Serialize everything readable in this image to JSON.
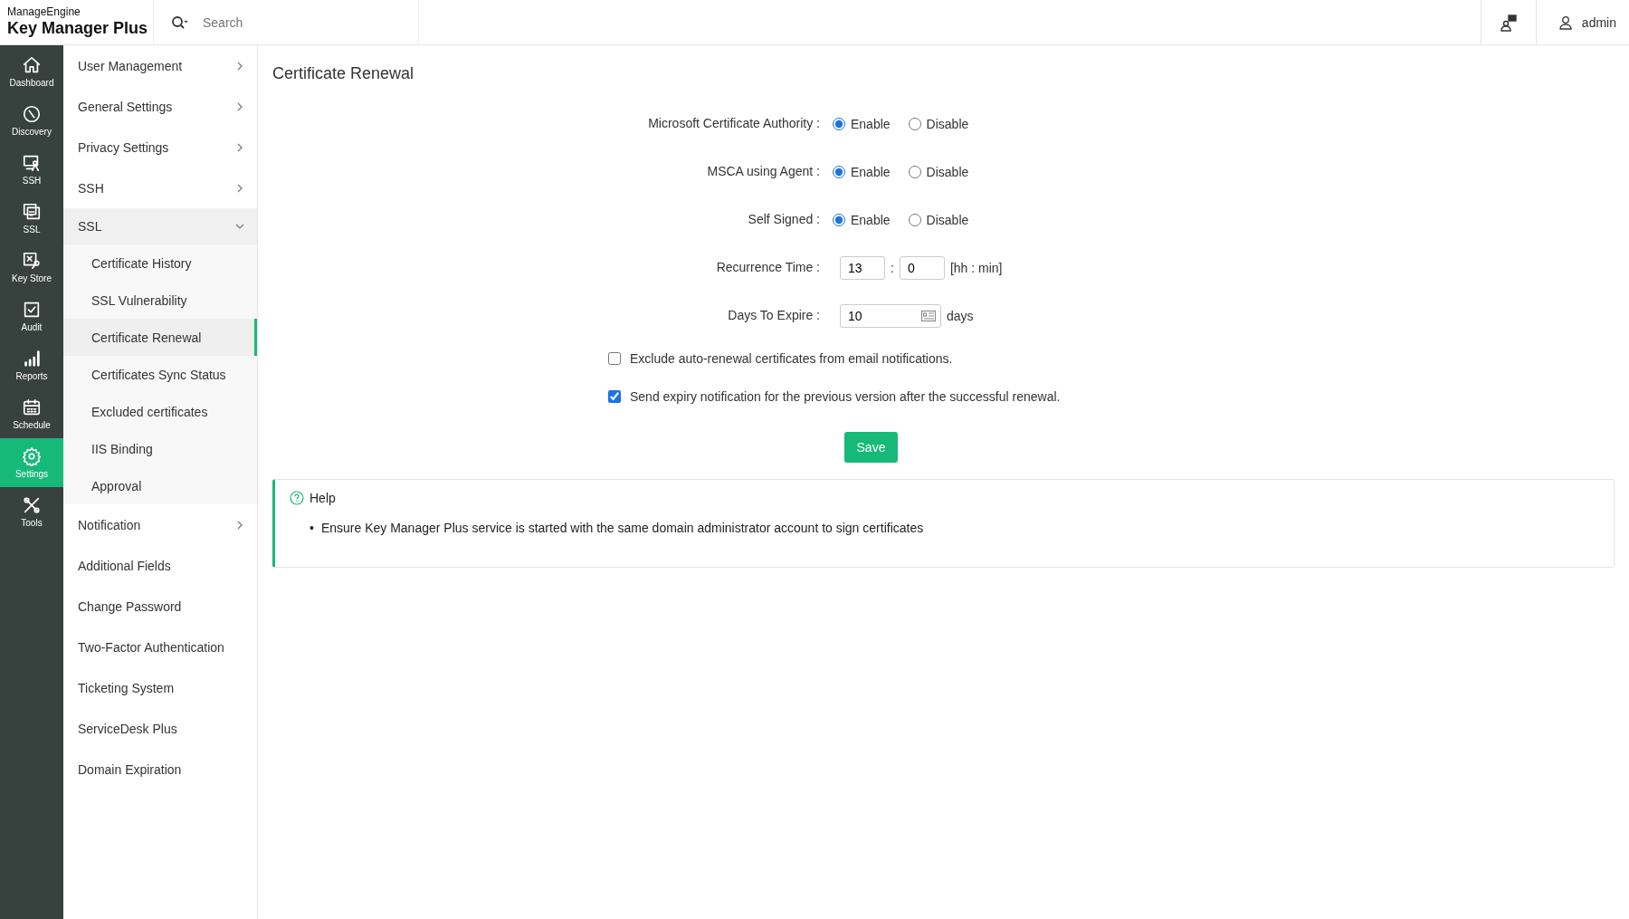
{
  "header": {
    "brand_top": "ManageEngine",
    "brand": "Key Manager Plus",
    "search": {
      "placeholder": "Search"
    },
    "user": "admin"
  },
  "rail": [
    {
      "label": "Dashboard",
      "selected": false
    },
    {
      "label": "Discovery",
      "selected": false
    },
    {
      "label": "SSH",
      "selected": false
    },
    {
      "label": "SSL",
      "selected": false
    },
    {
      "label": "Key Store",
      "selected": false
    },
    {
      "label": "Audit",
      "selected": false
    },
    {
      "label": "Reports",
      "selected": false
    },
    {
      "label": "Schedule",
      "selected": false
    },
    {
      "label": "Settings",
      "selected": true
    },
    {
      "label": "Tools",
      "selected": false
    }
  ],
  "sidebar": {
    "items": [
      {
        "label": "User Management",
        "kind": "group",
        "expanded": false
      },
      {
        "label": "General Settings",
        "kind": "group",
        "expanded": false
      },
      {
        "label": "Privacy Settings",
        "kind": "group",
        "expanded": false
      },
      {
        "label": "SSH",
        "kind": "group",
        "expanded": false
      },
      {
        "label": "SSL",
        "kind": "group",
        "expanded": true,
        "children": [
          {
            "label": "Certificate History",
            "selected": false
          },
          {
            "label": "SSL Vulnerability",
            "selected": false
          },
          {
            "label": "Certificate Renewal",
            "selected": true
          },
          {
            "label": "Certificates Sync Status",
            "selected": false
          },
          {
            "label": "Excluded certificates",
            "selected": false
          },
          {
            "label": "IIS Binding",
            "selected": false
          },
          {
            "label": "Approval",
            "selected": false
          }
        ]
      },
      {
        "label": "Notification",
        "kind": "group",
        "expanded": false
      },
      {
        "label": "Additional Fields",
        "kind": "link"
      },
      {
        "label": "Change Password",
        "kind": "link"
      },
      {
        "label": "Two-Factor Authentication",
        "kind": "link"
      },
      {
        "label": "Ticketing System",
        "kind": "link"
      },
      {
        "label": "ServiceDesk Plus",
        "kind": "link"
      },
      {
        "label": "Domain Expiration",
        "kind": "link"
      }
    ]
  },
  "page": {
    "title": "Certificate Renewal",
    "rows": [
      {
        "kind": "radio",
        "label": "Microsoft Certificate Authority :",
        "options": [
          {
            "label": "Enable",
            "selected": true
          },
          {
            "label": "Disable",
            "selected": false
          }
        ]
      },
      {
        "kind": "radio",
        "label": "MSCA using Agent :",
        "options": [
          {
            "label": "Enable",
            "selected": true
          },
          {
            "label": "Disable",
            "selected": false
          }
        ]
      },
      {
        "kind": "radio",
        "label": "Self Signed :",
        "options": [
          {
            "label": "Enable",
            "selected": true
          },
          {
            "label": "Disable",
            "selected": false
          }
        ]
      },
      {
        "kind": "time",
        "label": "Recurrence Time :",
        "hours": "13",
        "separator": ":",
        "minutes": "0",
        "unit": "[hh : min]"
      },
      {
        "kind": "days",
        "label": "Days To Expire :",
        "value": "10",
        "unit": "days"
      }
    ],
    "checkboxes": [
      {
        "label": "Exclude auto-renewal certificates from email notifications.",
        "checked": false
      },
      {
        "label": "Send expiry notification for the previous version after the successful renewal.",
        "checked": true
      }
    ],
    "save": "Save",
    "help": {
      "title": "Help",
      "items": [
        {
          "marker": "•",
          "text": "Ensure Key Manager Plus service is started with the same domain administrator account to sign certificates"
        }
      ]
    }
  }
}
